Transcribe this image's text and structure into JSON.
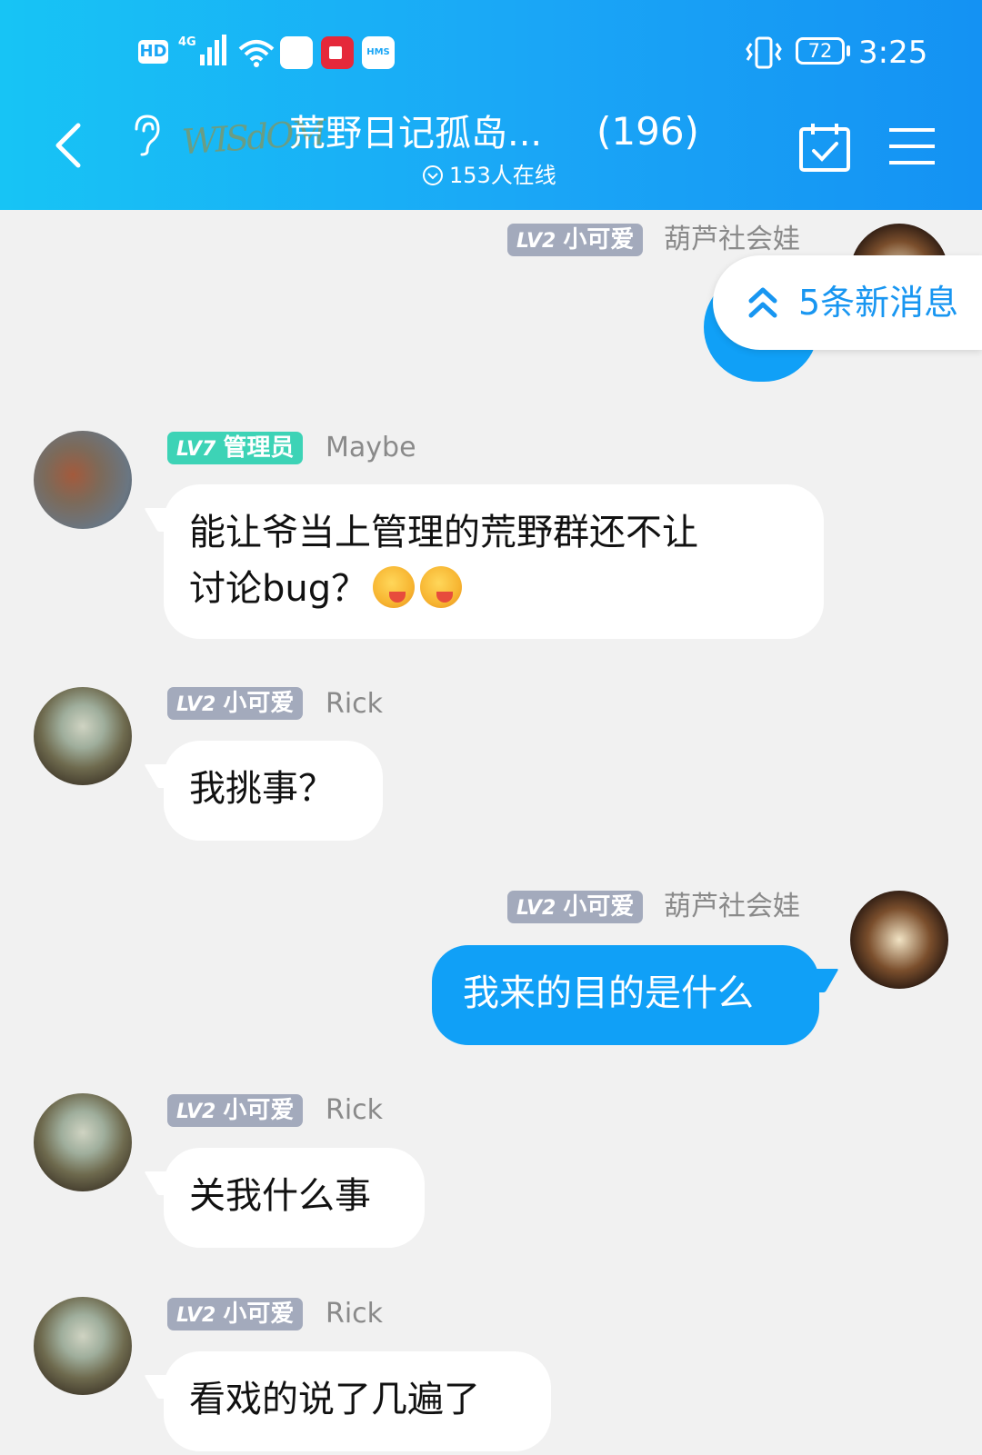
{
  "status_bar": {
    "hd": "HD",
    "network": "4G",
    "hms": "HMS",
    "battery": "72",
    "time": "3:25"
  },
  "header": {
    "logo_text": "WISdOM",
    "title": "荒野日记孤岛...",
    "member_count": "(196)",
    "online": "153人在线"
  },
  "new_messages": {
    "label": "5条新消息"
  },
  "messages": [
    {
      "sender": "葫芦社会娃",
      "level": "LV2",
      "title": "小可爱",
      "self": true,
      "text": ""
    },
    {
      "sender": "Maybe",
      "level": "LV7",
      "title": "管理员",
      "self": false,
      "text_line1": "能让爷当上管理的荒野群还不让",
      "text_line2": "讨论bug？"
    },
    {
      "sender": "Rick",
      "level": "LV2",
      "title": "小可爱",
      "self": false,
      "text": "我挑事？"
    },
    {
      "sender": "葫芦社会娃",
      "level": "LV2",
      "title": "小可爱",
      "self": true,
      "text": "我来的目的是什么"
    },
    {
      "sender": "Rick",
      "level": "LV2",
      "title": "小可爱",
      "self": false,
      "text": "关我什么事"
    },
    {
      "sender": "Rick",
      "level": "LV2",
      "title": "小可爱",
      "self": false,
      "text": "看戏的说了几遍了"
    }
  ],
  "colors": {
    "header_start": "#17c4f5",
    "header_end": "#1492f3",
    "self_bubble": "#10a0f7",
    "badge_grey": "#a3aabc",
    "badge_admin": "#3dd3b6",
    "chat_bg": "#f1f1f1"
  }
}
